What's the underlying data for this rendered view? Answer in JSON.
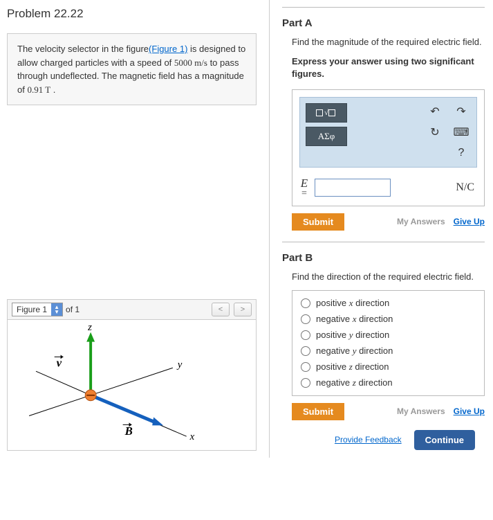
{
  "problem": {
    "title": "Problem 22.22",
    "text_pre": "The velocity selector in the figure",
    "figure_link": "(Figure 1)",
    "text_post1": " is designed to allow charged particles with a speed of ",
    "speed": "5000 m/s",
    "text_post2": " to pass through undeflected. The magnetic field has a magnitude of ",
    "mag": "0.91 T",
    "text_post3": " ."
  },
  "figure": {
    "selector_label": "Figure 1",
    "of_text": "of 1",
    "labels": {
      "z": "z",
      "y": "y",
      "x": "x",
      "v": "v",
      "B": "B"
    }
  },
  "partA": {
    "title": "Part A",
    "prompt": "Find the magnitude of the required electric field.",
    "instruction": "Express your answer using two significant figures.",
    "tools": {
      "templates_label": "▭√▭",
      "greek_label": "ΑΣφ",
      "help": "?"
    },
    "variable": "E",
    "equals": "=",
    "value": "",
    "unit": "N/C",
    "submit": "Submit",
    "my_answers": "My Answers",
    "give_up": "Give Up"
  },
  "partB": {
    "title": "Part B",
    "prompt": "Find the direction of the required electric field.",
    "choices": [
      {
        "pre": "positive ",
        "var": "x",
        "post": " direction"
      },
      {
        "pre": "negative ",
        "var": "x",
        "post": " direction"
      },
      {
        "pre": "positive ",
        "var": "y",
        "post": " direction"
      },
      {
        "pre": "negative ",
        "var": "y",
        "post": " direction"
      },
      {
        "pre": "positive ",
        "var": "z",
        "post": " direction"
      },
      {
        "pre": "negative ",
        "var": "z",
        "post": " direction"
      }
    ],
    "submit": "Submit",
    "my_answers": "My Answers",
    "give_up": "Give Up"
  },
  "footer": {
    "feedback": "Provide Feedback",
    "continue": "Continue"
  }
}
